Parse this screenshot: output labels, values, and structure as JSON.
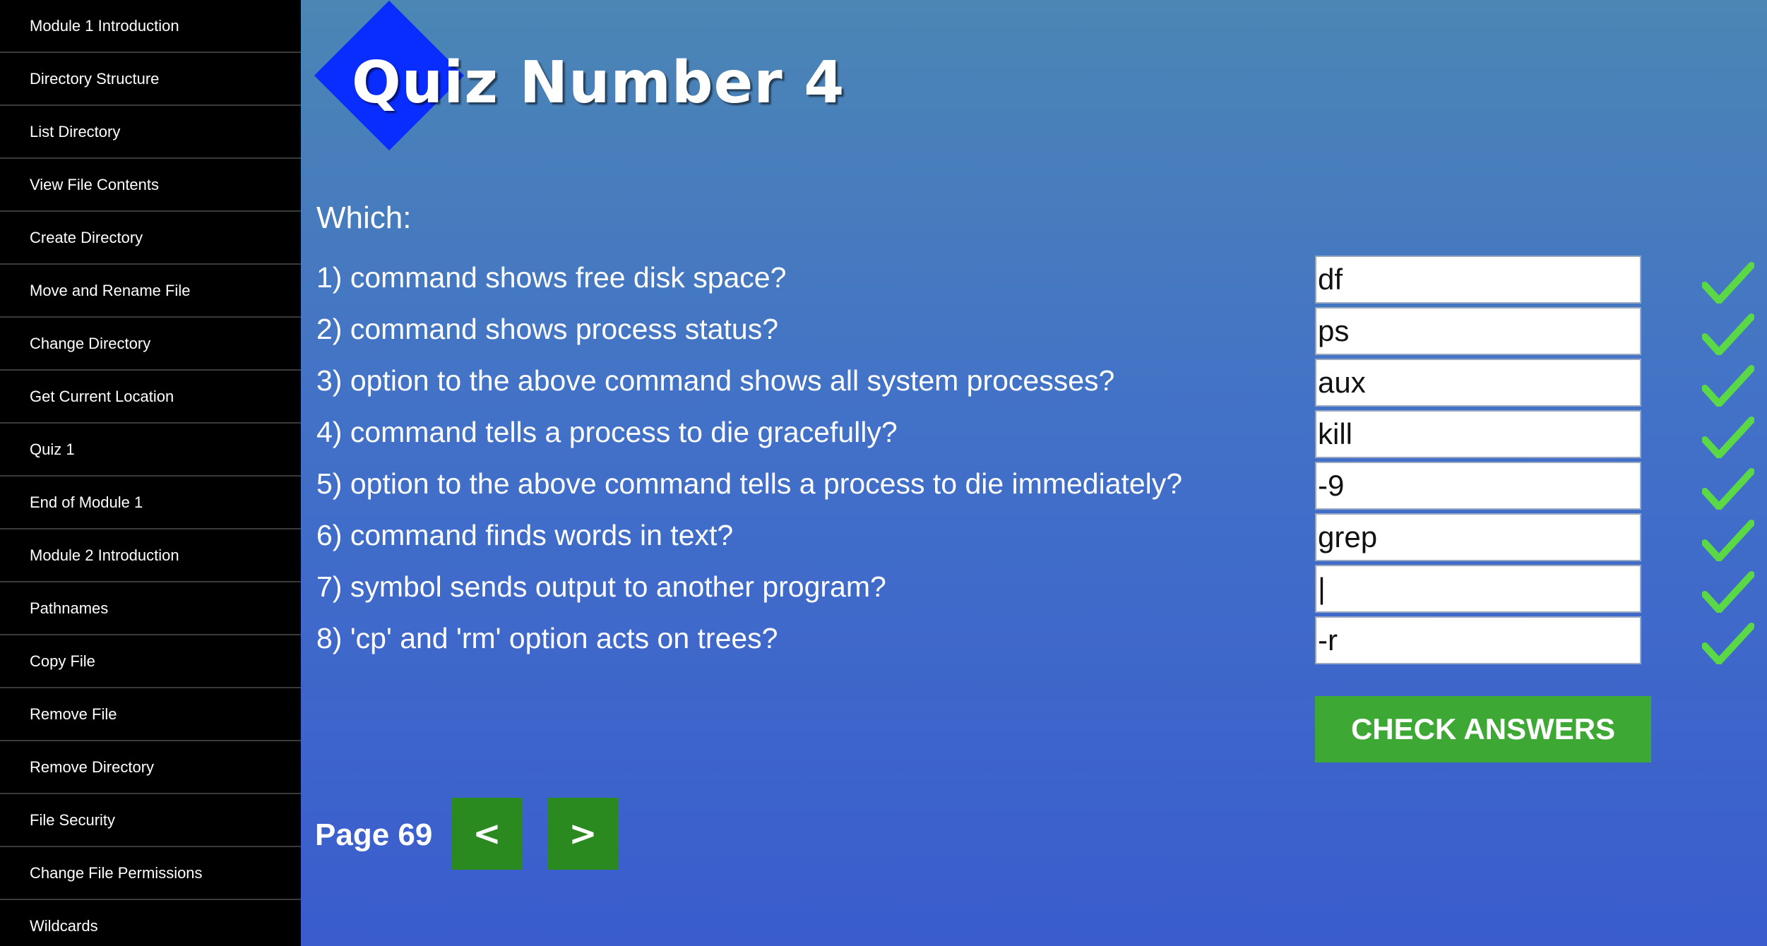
{
  "sidebar": {
    "items": [
      {
        "label": "Module 1 Introduction"
      },
      {
        "label": "Directory Structure"
      },
      {
        "label": "List Directory"
      },
      {
        "label": "View File Contents"
      },
      {
        "label": "Create Directory"
      },
      {
        "label": "Move and Rename File"
      },
      {
        "label": "Change Directory"
      },
      {
        "label": "Get Current Location"
      },
      {
        "label": "Quiz 1"
      },
      {
        "label": "End of Module 1"
      },
      {
        "label": "Module 2 Introduction"
      },
      {
        "label": "Pathnames"
      },
      {
        "label": "Copy File"
      },
      {
        "label": "Remove File"
      },
      {
        "label": "Remove Directory"
      },
      {
        "label": "File Security"
      },
      {
        "label": "Change File Permissions"
      },
      {
        "label": "Wildcards"
      }
    ]
  },
  "header": {
    "title": "Quiz Number 4",
    "logo_color": "#0a2dff"
  },
  "quiz": {
    "prompt": "Which:",
    "questions": [
      {
        "text": "1) command shows free disk space?",
        "answer": "df",
        "status": "check-icon"
      },
      {
        "text": "2) command shows process status?",
        "answer": "ps",
        "status": "check-icon"
      },
      {
        "text": "3) option to the above command shows all system processes?",
        "answer": "aux",
        "status": "check-icon"
      },
      {
        "text": "4) command tells a process to die gracefully?",
        "answer": "kill",
        "status": "check-icon"
      },
      {
        "text": "5) option to the above command tells a process to die immediately?",
        "answer": "-9",
        "status": "check-icon"
      },
      {
        "text": "6) command finds words in text?",
        "answer": "grep",
        "status": "check-icon"
      },
      {
        "text": "7) symbol sends output to another program?",
        "answer": "|",
        "status": "check-icon"
      },
      {
        "text": "8) 'cp' and 'rm' option acts on trees?",
        "answer": "-r",
        "status": "check-icon"
      }
    ],
    "check_button_label": "CHECK ANSWERS",
    "check_color": "#5bd845",
    "button_color": "#3ea834"
  },
  "navigation": {
    "page_label": "Page 69",
    "prev_label": "<",
    "next_label": ">"
  }
}
